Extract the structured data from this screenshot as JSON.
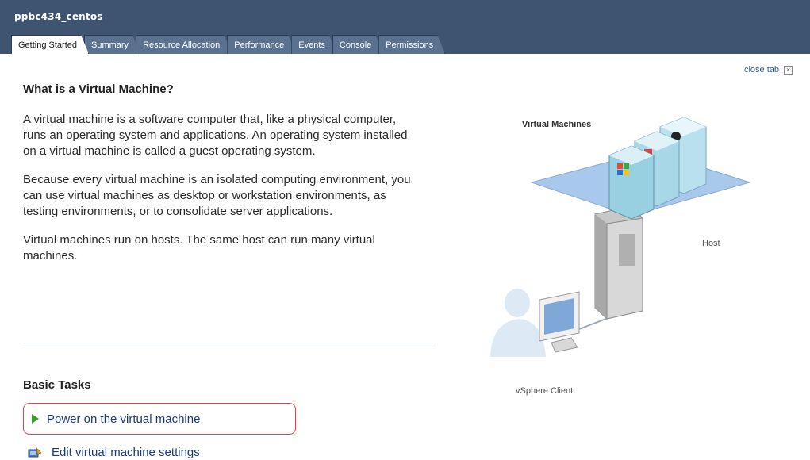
{
  "header": {
    "vm_name": "ppbc434_centos",
    "tabs": [
      {
        "label": "Getting Started",
        "active": true
      },
      {
        "label": "Summary",
        "active": false
      },
      {
        "label": "Resource Allocation",
        "active": false
      },
      {
        "label": "Performance",
        "active": false
      },
      {
        "label": "Events",
        "active": false
      },
      {
        "label": "Console",
        "active": false
      },
      {
        "label": "Permissions",
        "active": false
      }
    ]
  },
  "close_tab": {
    "label": "close tab",
    "icon": "close-icon"
  },
  "intro": {
    "heading": "What is a Virtual Machine?",
    "paragraphs": [
      "A virtual machine is a software computer that, like a physical computer, runs an operating system and applications. An operating system installed on a virtual machine is called a guest operating system.",
      "Because every virtual machine is an isolated computing environment, you can use virtual machines as desktop or workstation environments, as testing environments, or to consolidate server applications.",
      "Virtual machines run on hosts. The same host can run many virtual machines."
    ]
  },
  "illustration": {
    "vm_label": "Virtual Machines",
    "host_label": "Host",
    "client_label": "vSphere Client"
  },
  "basic_tasks": {
    "title": "Basic Tasks",
    "items": [
      {
        "label": "Power on the virtual machine",
        "icon": "play-icon",
        "highlighted": true
      },
      {
        "label": "Edit virtual machine settings",
        "icon": "settings-icon",
        "highlighted": false
      }
    ]
  },
  "colors": {
    "header_bg": "#3e5470",
    "highlight_border": "#e04545",
    "link": "#1a3a7a"
  }
}
